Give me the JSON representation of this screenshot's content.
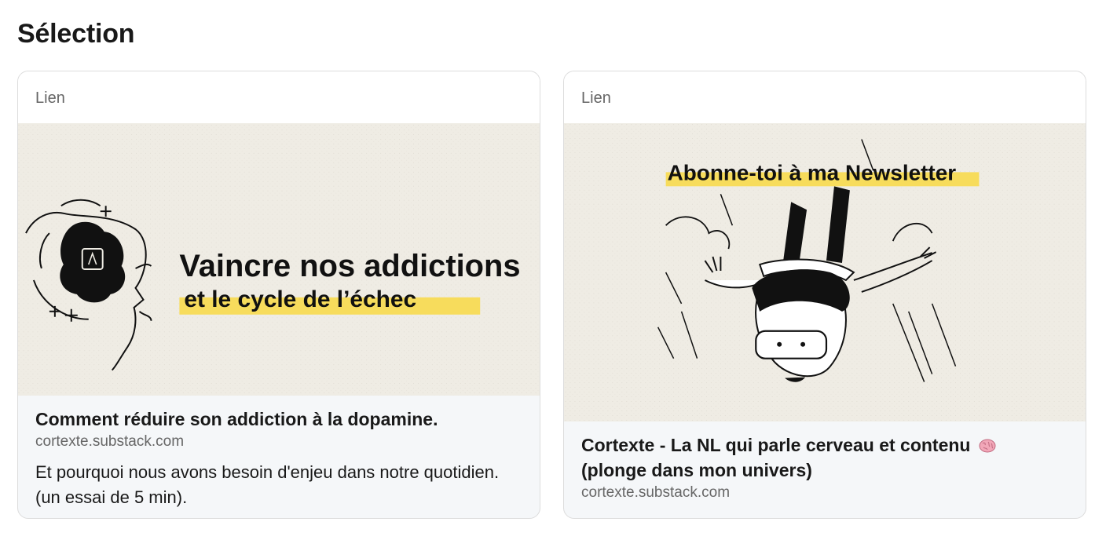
{
  "section": {
    "title": "Sélection"
  },
  "cards": [
    {
      "type_label": "Lien",
      "image": {
        "headline_line1": "Vaincre nos addictions",
        "headline_line2": "et le cycle de l’échec",
        "highlight_color": "#f7dc5c"
      },
      "title": "Comment réduire son addiction à la dopamine.",
      "domain": "cortexte.substack.com",
      "description": "Et pourquoi nous avons besoin d'enjeu dans notre quotidien. (un essai de 5 min)."
    },
    {
      "type_label": "Lien",
      "image": {
        "headline": "Abonne-toi à ma Newsletter",
        "highlight_color": "#f7dc5c"
      },
      "title": "Cortexte - La NL qui parle cerveau et contenu",
      "title_line2": "(plonge dans mon univers)",
      "title_emoji": "brain-emoji",
      "domain": "cortexte.substack.com"
    }
  ],
  "colors": {
    "card_border": "#dcdcdc",
    "card_footer_bg": "#f5f7f9",
    "image_bg": "#efece4",
    "muted_text": "#666666",
    "text": "#191919"
  }
}
